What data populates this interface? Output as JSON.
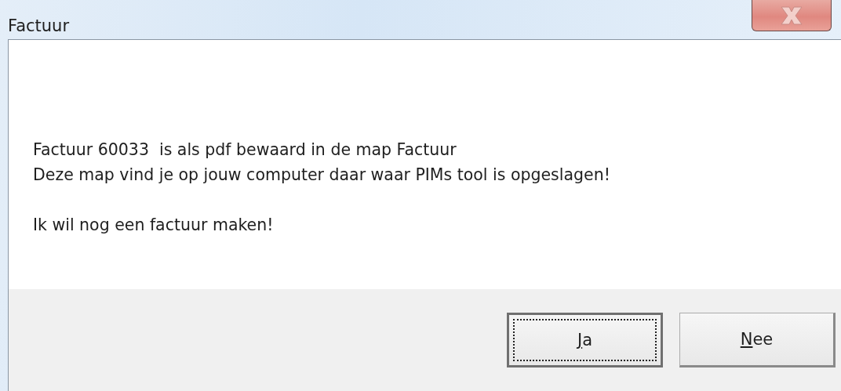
{
  "window": {
    "title": "Factuur"
  },
  "message": {
    "paragraphs": [
      [
        "Factuur 60033  is als pdf bewaard in de map Factuur",
        "Deze map vind je op jouw computer daar waar PIMs tool is opgeslagen!"
      ],
      [
        "Ik wil nog een factuur maken!"
      ]
    ]
  },
  "buttons": [
    {
      "label": "Ja",
      "focused": true
    },
    {
      "label": "Nee",
      "focused": false
    }
  ]
}
